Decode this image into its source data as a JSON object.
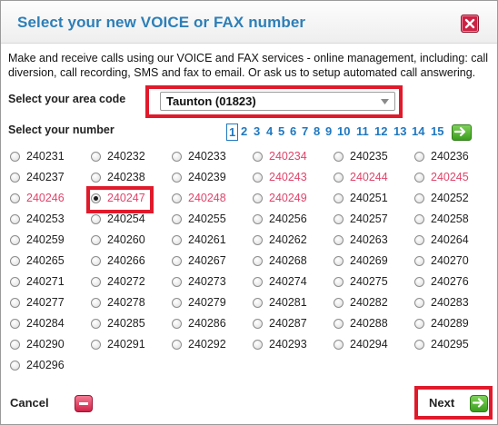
{
  "dialog": {
    "title": "Select your new VOICE or FAX number",
    "intro": "Make and receive calls using our VOICE and FAX services - online management, including: call diversion, call recording, SMS and fax to email. Or ask us to setup automated call answering."
  },
  "area": {
    "label": "Select your area code",
    "selected": "Taunton (01823)"
  },
  "numbers": {
    "label": "Select your number",
    "pages": [
      "1",
      "2",
      "3",
      "4",
      "5",
      "6",
      "7",
      "8",
      "9",
      "10",
      "11",
      "12",
      "13",
      "14",
      "15"
    ],
    "current_page": "1",
    "items": [
      {
        "n": "240231",
        "taken": false
      },
      {
        "n": "240232",
        "taken": false
      },
      {
        "n": "240233",
        "taken": false
      },
      {
        "n": "240234",
        "taken": true
      },
      {
        "n": "240235",
        "taken": false
      },
      {
        "n": "240236",
        "taken": false
      },
      {
        "n": "240237",
        "taken": false
      },
      {
        "n": "240238",
        "taken": false
      },
      {
        "n": "240239",
        "taken": false
      },
      {
        "n": "240243",
        "taken": true
      },
      {
        "n": "240244",
        "taken": true
      },
      {
        "n": "240245",
        "taken": true
      },
      {
        "n": "240246",
        "taken": true
      },
      {
        "n": "240247",
        "taken": true,
        "selected": true
      },
      {
        "n": "240248",
        "taken": true
      },
      {
        "n": "240249",
        "taken": true
      },
      {
        "n": "240251",
        "taken": false
      },
      {
        "n": "240252",
        "taken": false
      },
      {
        "n": "240253",
        "taken": false
      },
      {
        "n": "240254",
        "taken": false
      },
      {
        "n": "240255",
        "taken": false
      },
      {
        "n": "240256",
        "taken": false
      },
      {
        "n": "240257",
        "taken": false
      },
      {
        "n": "240258",
        "taken": false
      },
      {
        "n": "240259",
        "taken": false
      },
      {
        "n": "240260",
        "taken": false
      },
      {
        "n": "240261",
        "taken": false
      },
      {
        "n": "240262",
        "taken": false
      },
      {
        "n": "240263",
        "taken": false
      },
      {
        "n": "240264",
        "taken": false
      },
      {
        "n": "240265",
        "taken": false
      },
      {
        "n": "240266",
        "taken": false
      },
      {
        "n": "240267",
        "taken": false
      },
      {
        "n": "240268",
        "taken": false
      },
      {
        "n": "240269",
        "taken": false
      },
      {
        "n": "240270",
        "taken": false
      },
      {
        "n": "240271",
        "taken": false
      },
      {
        "n": "240272",
        "taken": false
      },
      {
        "n": "240273",
        "taken": false
      },
      {
        "n": "240274",
        "taken": false
      },
      {
        "n": "240275",
        "taken": false
      },
      {
        "n": "240276",
        "taken": false
      },
      {
        "n": "240277",
        "taken": false
      },
      {
        "n": "240278",
        "taken": false
      },
      {
        "n": "240279",
        "taken": false
      },
      {
        "n": "240281",
        "taken": false
      },
      {
        "n": "240282",
        "taken": false
      },
      {
        "n": "240283",
        "taken": false
      },
      {
        "n": "240284",
        "taken": false
      },
      {
        "n": "240285",
        "taken": false
      },
      {
        "n": "240286",
        "taken": false
      },
      {
        "n": "240287",
        "taken": false
      },
      {
        "n": "240288",
        "taken": false
      },
      {
        "n": "240289",
        "taken": false
      },
      {
        "n": "240290",
        "taken": false
      },
      {
        "n": "240291",
        "taken": false
      },
      {
        "n": "240292",
        "taken": false
      },
      {
        "n": "240293",
        "taken": false
      },
      {
        "n": "240294",
        "taken": false
      },
      {
        "n": "240295",
        "taken": false
      },
      {
        "n": "240296",
        "taken": false
      }
    ]
  },
  "footer": {
    "cancel_label": "Cancel",
    "next_label": "Next"
  },
  "colors": {
    "title": "#2d7fb8",
    "highlight": "#e01a2b",
    "taken_number": "#e0446a",
    "page_link": "#1f78c1"
  },
  "icons": {
    "close": "close-icon",
    "dropdown": "chevron-down-icon",
    "pager_next": "arrow-right-icon",
    "cancel": "minus-icon",
    "next": "arrow-right-icon"
  }
}
